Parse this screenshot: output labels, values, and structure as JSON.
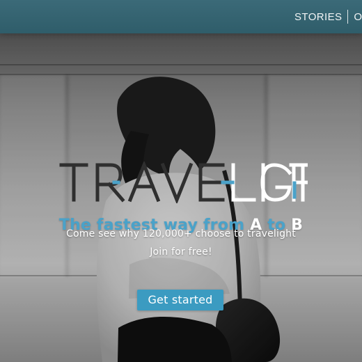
{
  "nav": {
    "items": [
      {
        "label": "STORIES"
      },
      {
        "label": "OUR"
      }
    ]
  },
  "hero": {
    "logo": {
      "text": "TRAVELIGHT",
      "dark_part": "TRAVE",
      "light_part": "LIGHT",
      "accent_color": "#4aa2c9"
    },
    "headline": {
      "prefix": "The fastest way from ",
      "a": "A",
      "middle": " to ",
      "b": "B"
    },
    "subhead": "Come see why 120,000+ choose to travelight",
    "join": "Join for free!",
    "cta_label": "Get started"
  },
  "colors": {
    "header": "#2f5d6a",
    "accent": "#3b9bc1",
    "white": "#ffffff"
  }
}
